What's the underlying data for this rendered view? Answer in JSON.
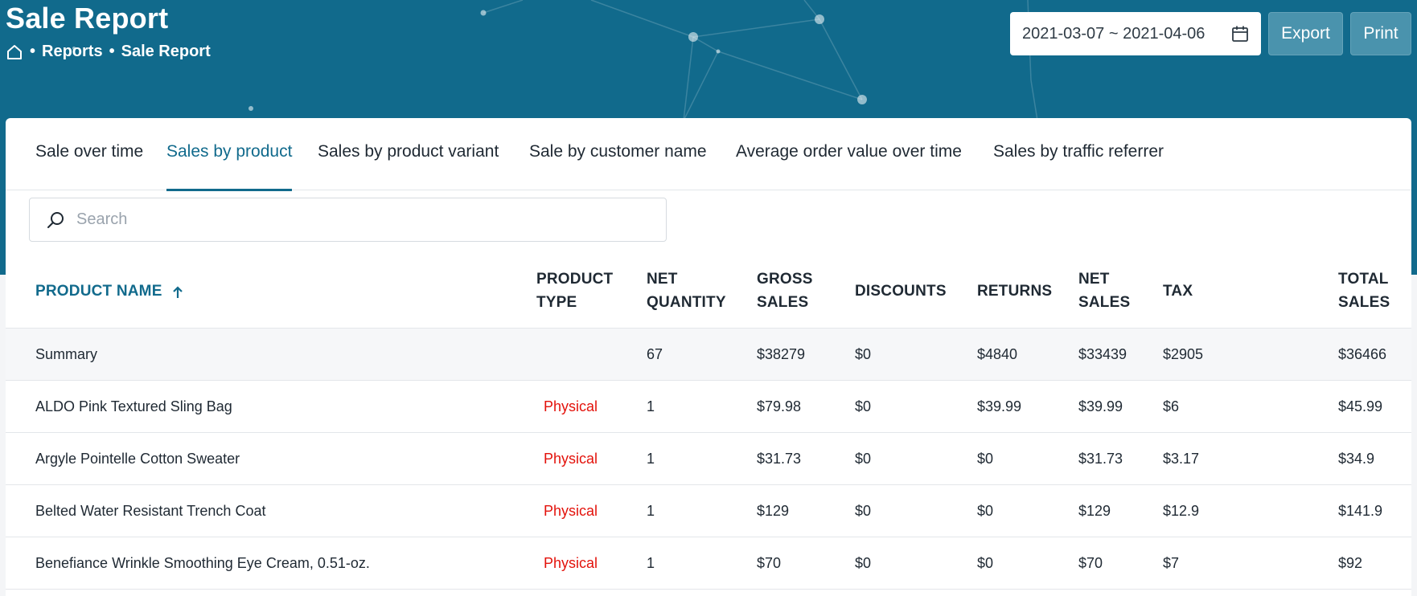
{
  "header": {
    "title": "Sale Report",
    "breadcrumb": [
      "•",
      "Reports",
      "•",
      "Sale Report"
    ],
    "date_range": "2021-03-07 ~ 2021-04-06",
    "export_label": "Export",
    "print_label": "Print"
  },
  "tabs": [
    {
      "label": "Sale over time"
    },
    {
      "label": "Sales by product"
    },
    {
      "label": "Sales by product variant"
    },
    {
      "label": "Sale by customer name"
    },
    {
      "label": "Average order value over time"
    },
    {
      "label": "Sales by traffic referrer"
    }
  ],
  "active_tab": "Sales by product",
  "search": {
    "placeholder": "Search",
    "value": ""
  },
  "table": {
    "headers": [
      {
        "line1": "PRODUCT NAME",
        "line2": ""
      },
      {
        "line1": "PRODUCT",
        "line2": "TYPE"
      },
      {
        "line1": "NET",
        "line2": "QUANTITY"
      },
      {
        "line1": "GROSS",
        "line2": "SALES"
      },
      {
        "line1": "DISCOUNTS",
        "line2": ""
      },
      {
        "line1": "RETURNS",
        "line2": ""
      },
      {
        "line1": "NET",
        "line2": "SALES"
      },
      {
        "line1": "TAX",
        "line2": ""
      },
      {
        "line1": "TOTAL",
        "line2": "SALES"
      }
    ],
    "sort": {
      "column": "PRODUCT NAME",
      "direction": "ascending"
    },
    "summary": [
      "Summary",
      "",
      "67",
      "$38279",
      "$0",
      "$4840",
      "$33439",
      "$2905",
      "$36466"
    ],
    "rows": [
      [
        "ALDO Pink Textured Sling Bag",
        "Physical",
        "1",
        "$79.98",
        "$0",
        "$39.99",
        "$39.99",
        "$6",
        "$45.99"
      ],
      [
        "Argyle Pointelle Cotton Sweater",
        "Physical",
        "1",
        "$31.73",
        "$0",
        "$0",
        "$31.73",
        "$3.17",
        "$34.9"
      ],
      [
        "Belted Water Resistant Trench Coat",
        "Physical",
        "1",
        "$129",
        "$0",
        "$0",
        "$129",
        "$12.9",
        "$141.9"
      ],
      [
        "Benefiance Wrinkle Smoothing Eye Cream, 0.51-oz.",
        "Physical",
        "1",
        "$70",
        "$0",
        "$0",
        "$70",
        "$7",
        "$92"
      ]
    ]
  },
  "colors": {
    "header_bg": "#116a8c",
    "accent": "#116a8c",
    "button_bg": "#4a93ad",
    "physical_type": "#e3120b"
  },
  "icons": [
    "home-icon",
    "calendar-icon",
    "search-icon",
    "arrow-up-icon"
  ]
}
